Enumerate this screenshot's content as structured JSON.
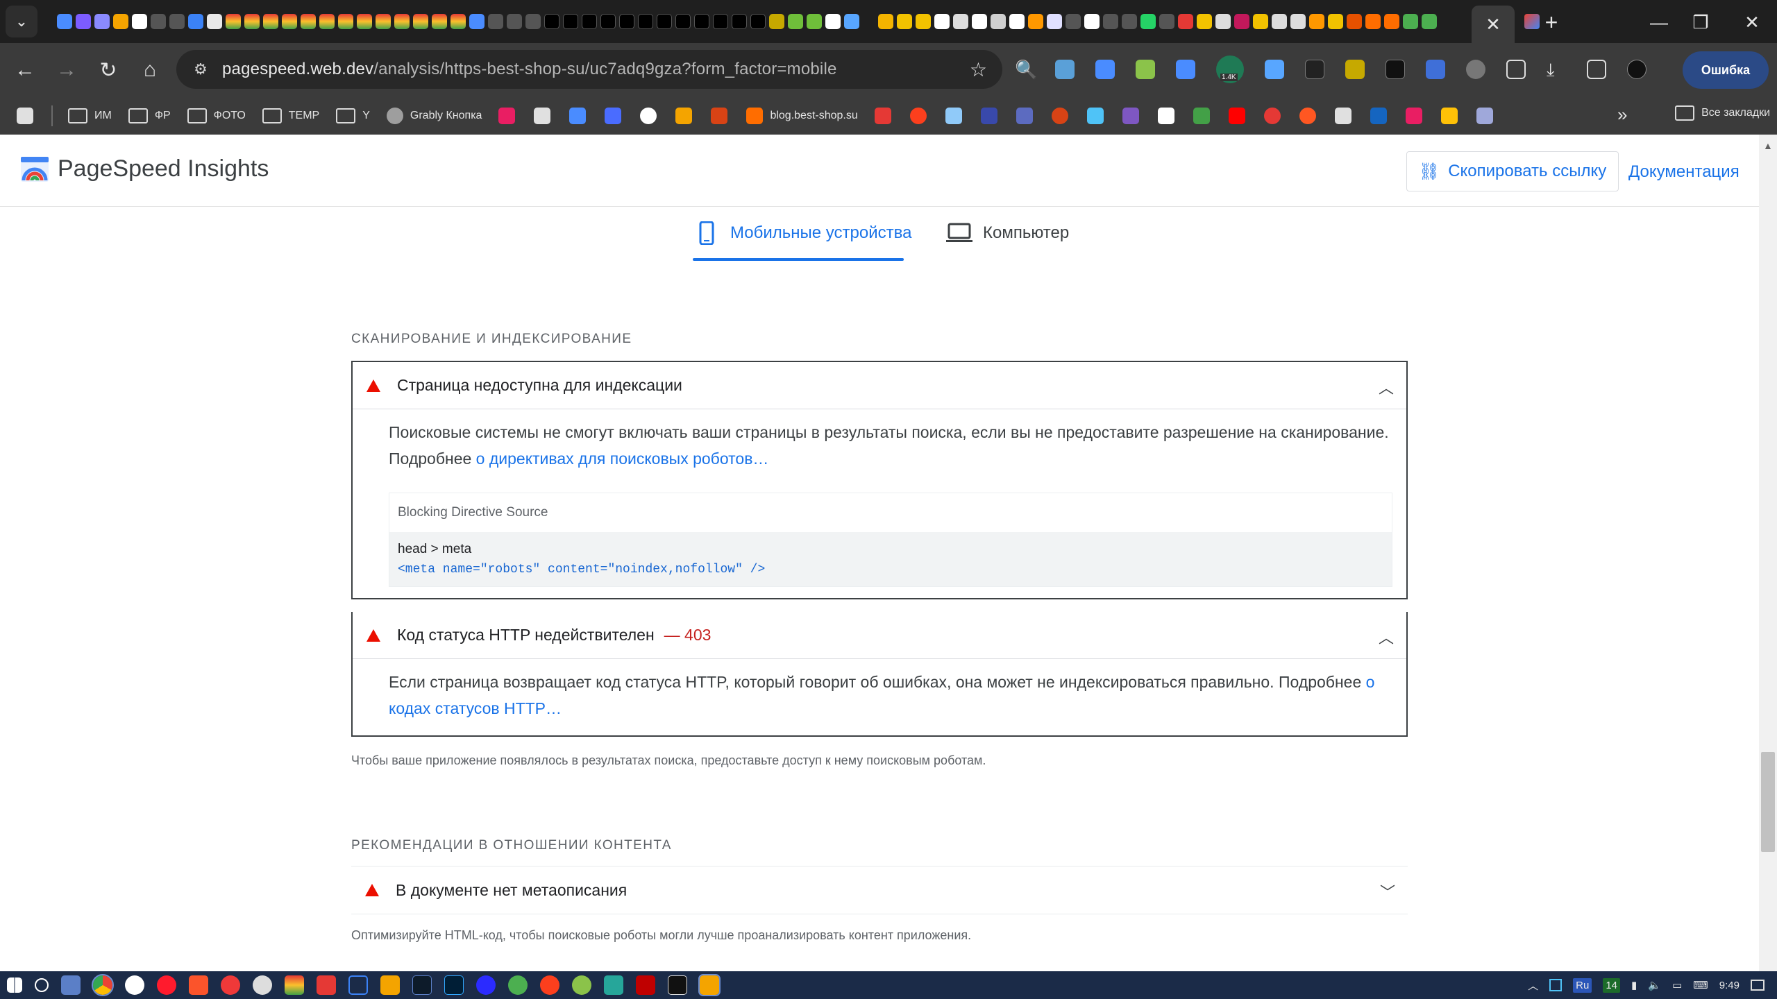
{
  "browser": {
    "url_host": "pagespeed.web.dev",
    "url_path": "/analysis/https-best-shop-su/uc7adq9gza?form_factor=mobile",
    "error_button_label": "Ошибка",
    "extension_badge": "1.4K",
    "bookmarks": {
      "folders": [
        "ИМ",
        "ФР",
        "ФОТО",
        "TEMP",
        "Y"
      ],
      "grably_label": "Grably Кнопка",
      "blog_label": "blog.best-shop.su",
      "all_bookmarks_label": "Все закладки"
    }
  },
  "header": {
    "title": "PageSpeed Insights",
    "copy_link_label": "Скопировать ссылку",
    "docs_label": "Документация"
  },
  "device_tabs": {
    "mobile_label": "Мобильные устройства",
    "desktop_label": "Компьютер"
  },
  "sections": {
    "crawl": {
      "title": "СКАНИРОВАНИЕ И ИНДЕКСИРОВАНИЕ",
      "audit1": {
        "title": "Страница недоступна для индексации",
        "desc_text": "Поисковые системы не смогут включать ваши страницы в результаты поиска, если вы не предоставите разрешение на сканирование. Подробнее ",
        "desc_link": "о директивах для поисковых роботов…",
        "table_header": "Blocking Directive Source",
        "row_main": "head > meta",
        "row_code": "<meta name=\"robots\" content=\"noindex,nofollow\" />"
      },
      "audit2": {
        "title": "Код статуса HTTP недействителен",
        "value": "— 403",
        "desc_text": "Если страница возвращает код статуса HTTP, который говорит об ошибках, она может не индексироваться правильно. Подробнее ",
        "desc_link": "о кодах статусов HTTP…"
      },
      "hint": "Чтобы ваше приложение появлялось в результатах поиска, предоставьте доступ к нему поисковым роботам."
    },
    "content": {
      "title": "РЕКОМЕНДАЦИИ В ОТНОШЕНИИ КОНТЕНТА",
      "audit1": {
        "title": "В документе нет метаописания"
      },
      "hint": "Оптимизируйте HTML-код, чтобы поисковые роботы могли лучше проанализировать контент приложения."
    }
  },
  "taskbar": {
    "lang": "Ru",
    "num": "14",
    "time": "9:49"
  }
}
